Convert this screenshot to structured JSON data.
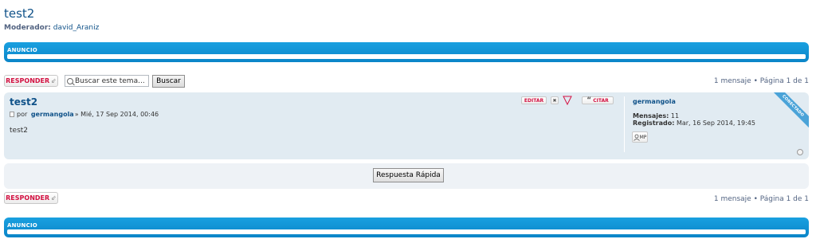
{
  "page": {
    "title": "test2",
    "moderator_label": "Moderador:",
    "moderator_name": "david_Araniz"
  },
  "announcement": {
    "header": "ANUNCIO"
  },
  "toolbar": {
    "reply_label": "RESPONDER",
    "reply_icon": "reply-arrow-icon",
    "search_placeholder": "Buscar este tema...",
    "search_button": "Buscar",
    "pagination": "1 mensaje • Página 1 de 1"
  },
  "post": {
    "title": "test2",
    "by_label": "por",
    "author": "germangola",
    "date": " » Mié, 17 Sep 2014, 00:46",
    "content": "test2",
    "edit_label": "EDITAR",
    "delete_label": "✖",
    "report_label": "!",
    "quote_label": "CITAR",
    "profile": {
      "name": "germangola",
      "posts_label": "Mensajes:",
      "posts_value": "11",
      "registered_label": "Registrado:",
      "registered_value": "Mar, 16 Sep 2014, 19:45",
      "pm_label": "MP",
      "status": "CONECTADO"
    }
  },
  "quick_reply": {
    "button": "Respuesta Rápida"
  },
  "bottom_toolbar": {
    "reply_label": "RESPONDER",
    "pagination": "1 mensaje • Página 1 de 1"
  },
  "bottom_announcement": {
    "header": "ANUNCIO"
  },
  "colors": {
    "link": "#105289",
    "accent_blue": "#0b85c8",
    "reply_red": "#d31141",
    "post_bg": "#e1ebf2"
  }
}
